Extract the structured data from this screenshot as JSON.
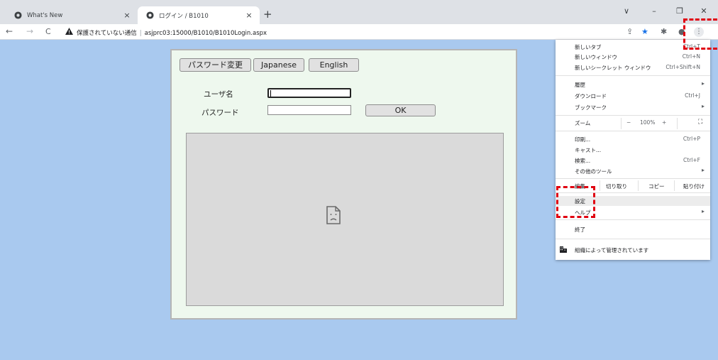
{
  "tabs": [
    {
      "title": "What's New",
      "close": "×"
    },
    {
      "title": "ログイン / B1010",
      "close": "×"
    }
  ],
  "new_tab": "+",
  "window_controls": [
    "∨",
    "–",
    "❐",
    "✕"
  ],
  "address_bar": {
    "security_label": "保護されていない通信",
    "url": "asjprc03:15000/B1010/B1010Login.aspx"
  },
  "nav": {
    "back": "←",
    "forward": "→",
    "reload": "C"
  },
  "toolbar_icons": [
    "share-icon",
    "star-icon",
    "extensions-icon",
    "profile-icon",
    "menu-icon"
  ],
  "login": {
    "buttons": {
      "password_change": "パスワード変更",
      "japanese": "Japanese",
      "english": "English"
    },
    "username_label": "ユーザ名",
    "password_label": "パスワード",
    "username_value": "",
    "password_value": "",
    "ok_label": "OK"
  },
  "menu": {
    "items": [
      {
        "label": "新しいタブ",
        "shortcut": "Ctrl+T"
      },
      {
        "label": "新しいウィンドウ",
        "shortcut": "Ctrl+N"
      },
      {
        "label": "新しいシークレット ウィンドウ",
        "shortcut": "Ctrl+Shift+N"
      },
      {
        "label": "履歴",
        "shortcut": "▸"
      },
      {
        "label": "ダウンロード",
        "shortcut": "Ctrl+J"
      },
      {
        "label": "ブックマーク",
        "shortcut": "▸"
      },
      {
        "label": "印刷...",
        "shortcut": "Ctrl+P"
      },
      {
        "label": "キャスト...",
        "shortcut": ""
      },
      {
        "label": "検索...",
        "shortcut": "Ctrl+F"
      },
      {
        "label": "その他のツール",
        "shortcut": "▸"
      },
      {
        "label": "設定",
        "shortcut": ""
      },
      {
        "label": "ヘルプ",
        "shortcut": "▸"
      },
      {
        "label": "終了",
        "shortcut": ""
      }
    ],
    "zoom": {
      "label": "ズーム",
      "minus": "−",
      "value": "100%",
      "plus": "+",
      "fullscreen": "⛶"
    },
    "edit": {
      "label": "編集",
      "cut": "切り取り",
      "copy": "コピー",
      "paste": "貼り付け"
    },
    "managed": "組織によって管理されています"
  },
  "colors": {
    "page_bg": "#a9c9ef",
    "panel_bg": "#eef8ee",
    "annotation": "#e00010"
  }
}
